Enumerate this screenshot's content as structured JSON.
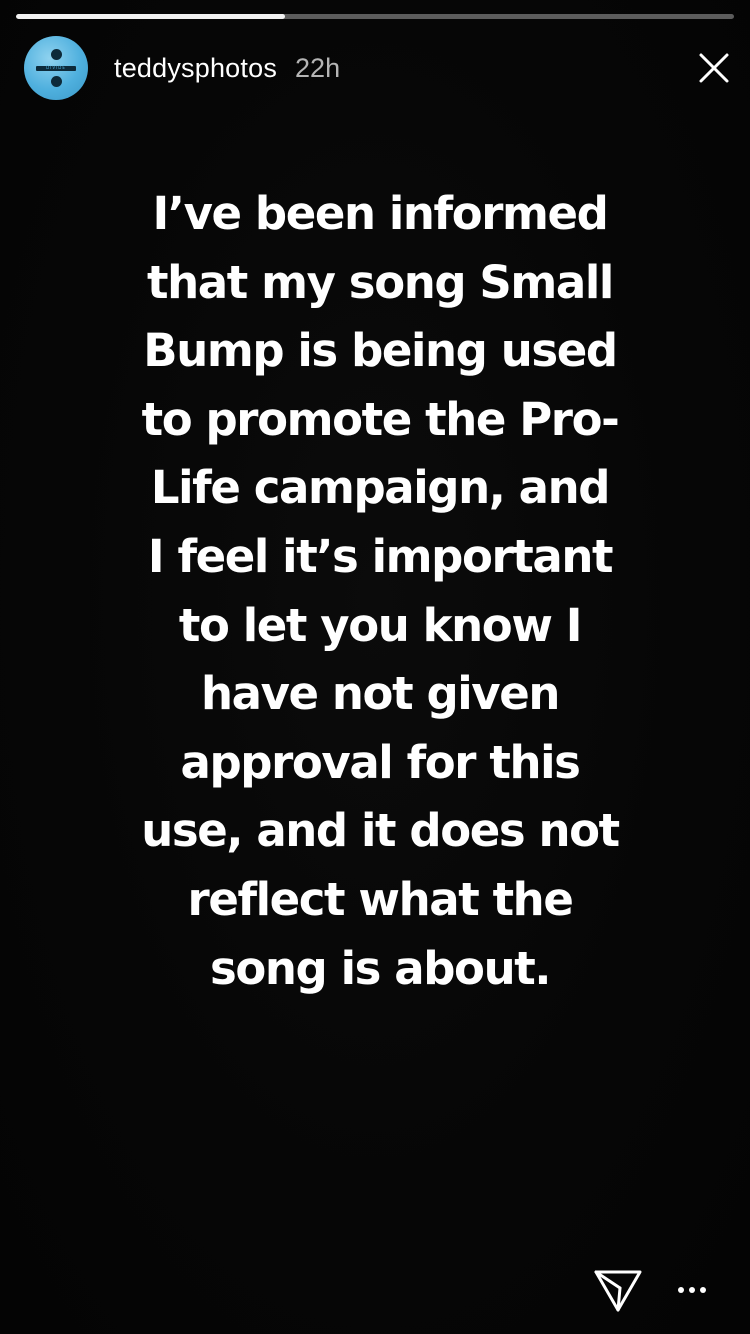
{
  "progress": {
    "fraction": 0.375,
    "fill_color": "#f2f2f2",
    "track_color": "rgba(255,255,255,0.35)"
  },
  "header": {
    "username": "teddysphotos",
    "timestamp": "22h",
    "avatar_icon": "divide-icon",
    "avatar_color": "#4fb0de",
    "avatar_text": "DIVIDE",
    "close_icon": "close-icon"
  },
  "message": {
    "lines": [
      "I’ve been informed",
      "that my song Small",
      "Bump is being used",
      "to promote the Pro-",
      "Life campaign, and",
      "I feel it’s important",
      "to let you know I",
      "have not given",
      "approval for this",
      "use, and it does not",
      "reflect what the",
      "song is about."
    ]
  },
  "footer": {
    "send_icon": "send-icon",
    "more_icon": "more-options-icon"
  },
  "colors": {
    "background": "#050505",
    "text": "#ffffff"
  }
}
